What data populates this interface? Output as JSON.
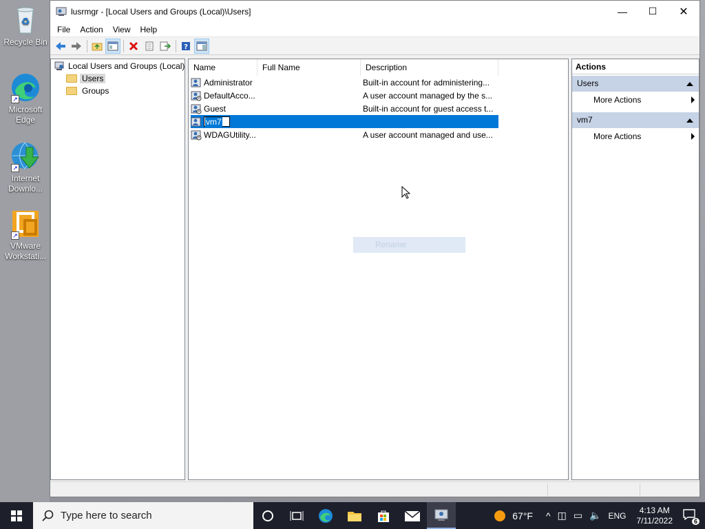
{
  "desktop": {
    "icons": [
      {
        "label": "Recycle Bin",
        "icon": "recycle-bin-icon"
      },
      {
        "label": "Microsoft Edge",
        "icon": "edge-icon"
      },
      {
        "label": "Internet Downlo...",
        "icon": "internet-download-manager-icon"
      },
      {
        "label": "VMware Workstati...",
        "icon": "vmware-icon"
      }
    ]
  },
  "window": {
    "title": "lusrmgr - [Local Users and Groups (Local)\\Users]",
    "controls": {
      "minimize": "—",
      "maximize": "☐",
      "close": "✕"
    },
    "menu": [
      "File",
      "Action",
      "View",
      "Help"
    ],
    "toolbar": [
      "back-icon",
      "forward-icon",
      "up-folder-icon",
      "show-hide-tree-icon",
      "delete-icon",
      "properties-icon",
      "export-list-icon",
      "help-icon",
      "show-hide-action-pane-icon"
    ]
  },
  "tree": {
    "root": "Local Users and Groups (Local)",
    "items": [
      {
        "label": "Users",
        "selected": true
      },
      {
        "label": "Groups",
        "selected": false
      }
    ]
  },
  "list": {
    "columns": [
      "Name",
      "Full Name",
      "Description"
    ],
    "rows": [
      {
        "name": "Administrator",
        "full_name": "",
        "description": "Built-in account for administering..."
      },
      {
        "name": "DefaultAcco...",
        "full_name": "",
        "description": "A user account managed by the s..."
      },
      {
        "name": "Guest",
        "full_name": "",
        "description": "Built-in account for guest access t..."
      },
      {
        "name": "vm7",
        "full_name": "",
        "description": "",
        "editing": true
      },
      {
        "name": "WDAGUtility...",
        "full_name": "",
        "description": "A user account managed and use..."
      }
    ],
    "context_ghost": "Rename"
  },
  "actions": {
    "header": "Actions",
    "groups": [
      {
        "title": "Users",
        "items": [
          "More Actions"
        ]
      },
      {
        "title": "vm7",
        "items": [
          "More Actions"
        ]
      }
    ]
  },
  "taskbar": {
    "search_placeholder": "Type here to search",
    "weather": "67°F",
    "language": "ENG",
    "time": "4:13 AM",
    "date": "7/11/2022",
    "notification_count": "6"
  }
}
